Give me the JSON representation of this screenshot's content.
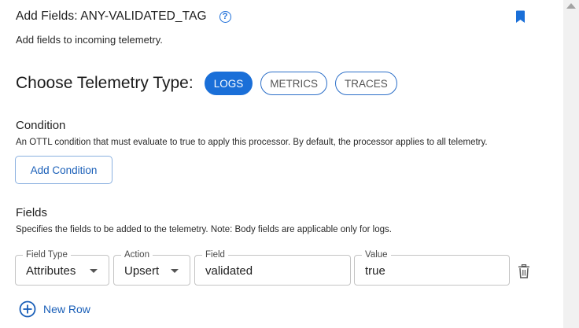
{
  "header": {
    "title": "Add Fields: ANY-VALIDATED_TAG",
    "help_icon": "question-circle-icon",
    "subtitle": "Add fields to incoming telemetry.",
    "bookmark_icon": "bookmark-icon"
  },
  "telemetry": {
    "label": "Choose Telemetry Type:",
    "options": [
      {
        "label": "LOGS",
        "selected": true
      },
      {
        "label": "METRICS",
        "selected": false
      },
      {
        "label": "TRACES",
        "selected": false
      }
    ]
  },
  "condition": {
    "title": "Condition",
    "description": "An OTTL condition that must evaluate to true to apply this processor. By default, the processor applies to all telemetry.",
    "add_button": "Add Condition"
  },
  "fields": {
    "title": "Fields",
    "description": "Specifies the fields to be added to the telemetry. Note: Body fields are applicable only for logs.",
    "row": {
      "field_type": {
        "label": "Field Type",
        "value": "Attributes"
      },
      "action": {
        "label": "Action",
        "value": "Upsert"
      },
      "field": {
        "label": "Field",
        "value": "validated"
      },
      "value": {
        "label": "Value",
        "value": "true"
      }
    },
    "delete_icon": "trash-icon",
    "new_row_label": "New Row",
    "new_row_icon": "plus-circle-icon"
  },
  "colors": {
    "accent": "#1a6fd8",
    "link": "#1a5fb8"
  }
}
